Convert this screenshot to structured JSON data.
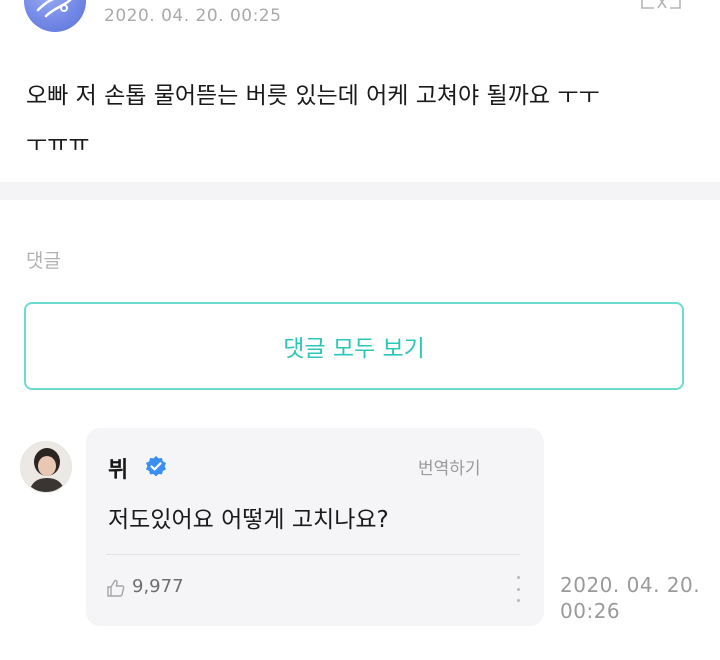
{
  "post": {
    "avatar_icon": "user-avatar-icon",
    "time": "2020. 04. 20. 00:25",
    "translate_icon": "translate-icon",
    "body_line1": "오빠 저 손톱 물어뜯는 버릇 있는데 어케 고쳐야 될까요 ㅜㅜ",
    "body_line2": "ㅜㅠㅠ"
  },
  "comments": {
    "label": "댓글",
    "view_all_label": "댓글 모두 보기",
    "accent_color": "#2cc7b6",
    "items": [
      {
        "author": "뷔",
        "verified_icon": "verified-check-icon",
        "translate_label": "번역하기",
        "text": "저도있어요 어떻게 고치나요?",
        "like_icon": "thumbs-up-icon",
        "likes": "9,977",
        "more_icon": "more-vertical-icon",
        "time_date": "2020. 04. 20.",
        "time_clock": "00:26"
      }
    ]
  }
}
